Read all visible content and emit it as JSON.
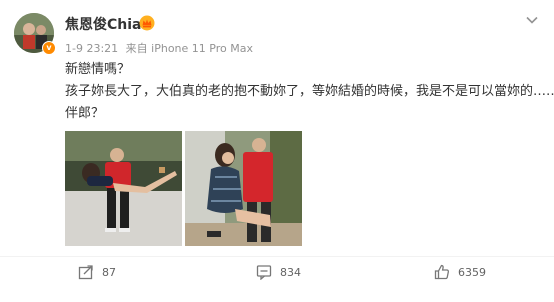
{
  "post": {
    "username": "焦恩俊Chiao",
    "timestamp": "1-9 23:21",
    "source": "来自 iPhone 11 Pro Max",
    "text_lines": [
      "新戀情嗎？",
      "孩子妳長大了，大伯真的老的抱不動妳了，等妳結婚的時候，我是不是可以當妳的………",
      "伴郎？"
    ]
  },
  "actions": {
    "share_count": "87",
    "comment_count": "834",
    "like_count": "6359"
  },
  "icons": {
    "avatar": "avatar-photo",
    "vip": "vip-crown-badge",
    "more": "chevron-down-icon",
    "share": "share-icon",
    "comment": "comment-icon",
    "like": "thumbs-up-icon"
  },
  "colors": {
    "username": "#333333",
    "meta": "#939393",
    "accent": "#ff8a00",
    "action_text": "#636363"
  }
}
